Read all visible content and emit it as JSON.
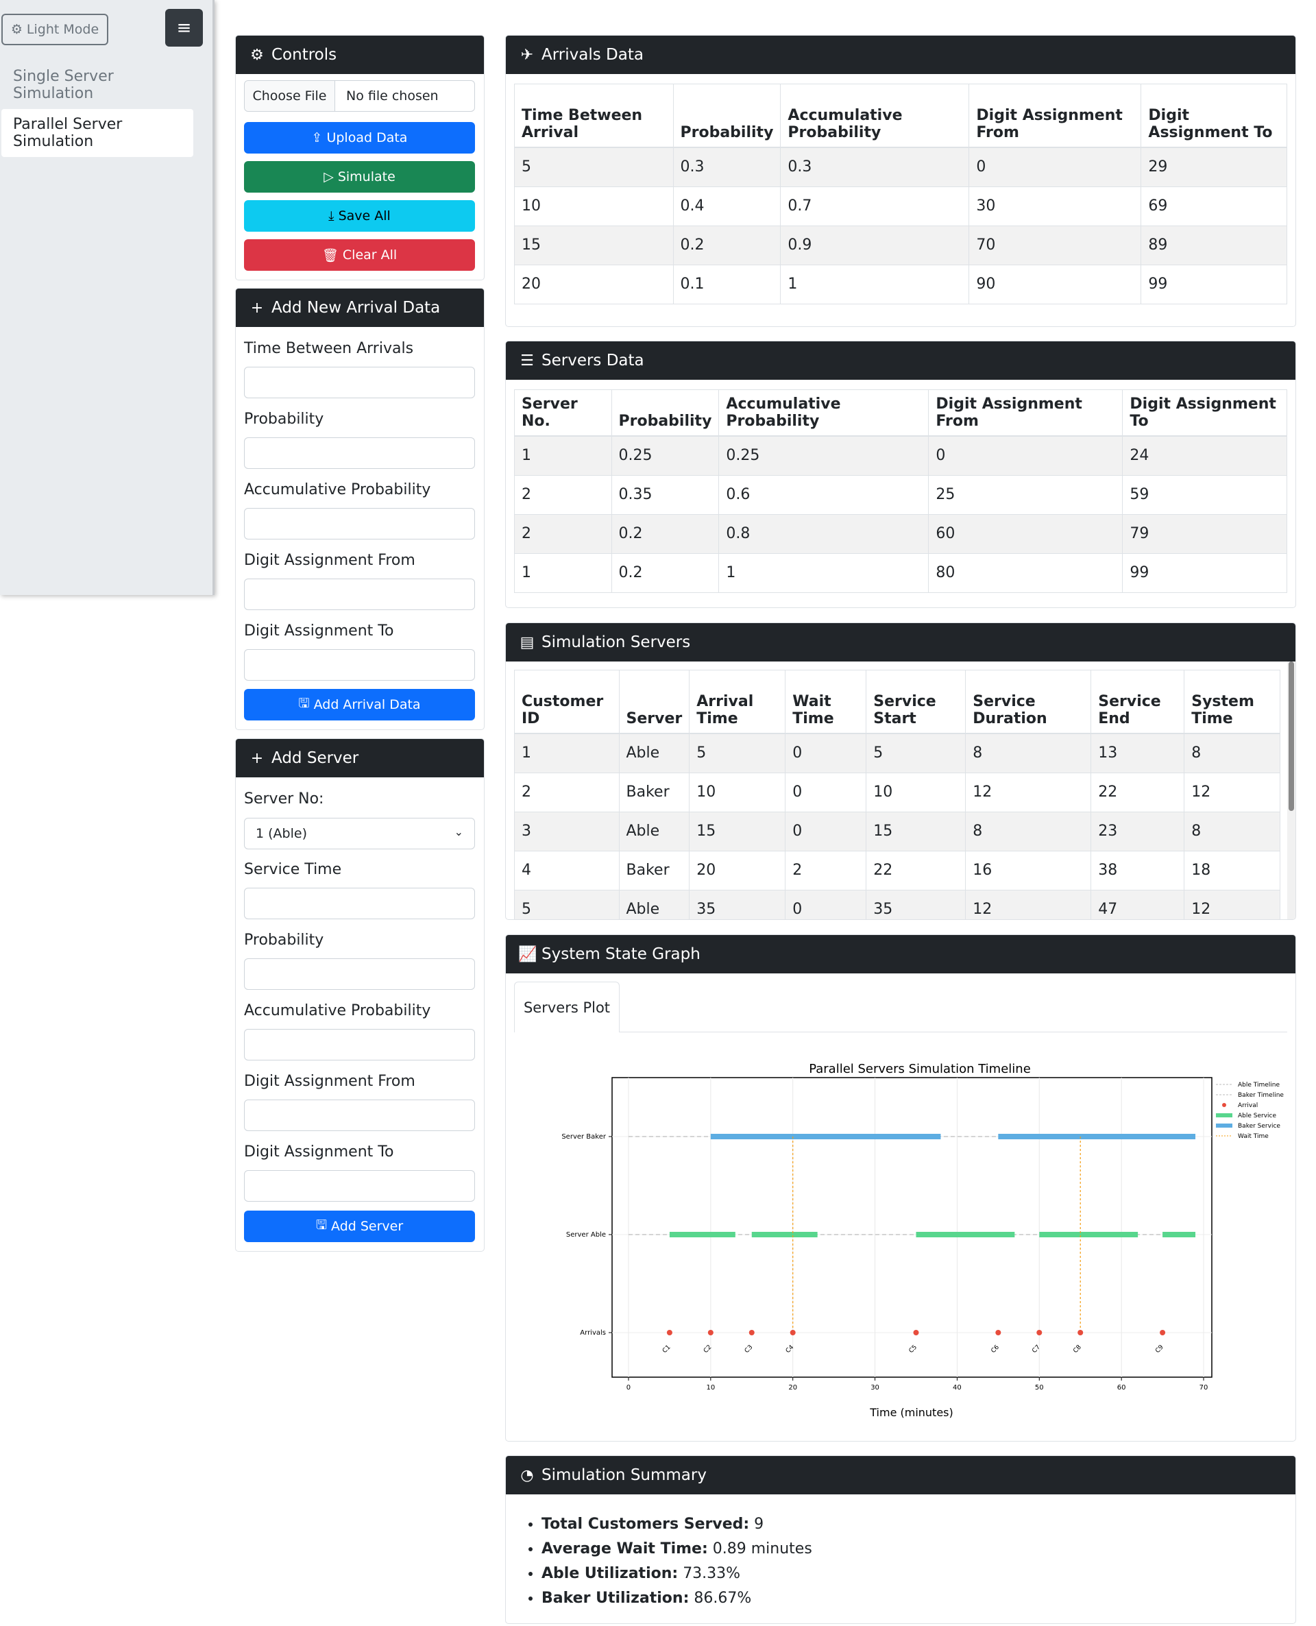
{
  "sidebar": {
    "mode_label": "Light Mode",
    "menu_icon": "hamburger-icon",
    "items": [
      {
        "label": "Single Server Simulation"
      },
      {
        "label": "Parallel Server Simulation"
      }
    ]
  },
  "controls": {
    "title": "Controls",
    "file_button": "Choose File",
    "file_status": "No file chosen",
    "upload_label": "Upload Data",
    "simulate_label": "Simulate",
    "save_label": "Save All",
    "clear_label": "Clear All"
  },
  "add_arrival": {
    "title": "Add New Arrival Data",
    "fields": [
      "Time Between Arrivals",
      "Probability",
      "Accumulative Probability",
      "Digit Assignment From",
      "Digit Assignment To"
    ],
    "button": "Add Arrival Data"
  },
  "add_server": {
    "title": "Add Server",
    "server_no_label": "Server No:",
    "server_no_value": "1 (Able)",
    "fields": [
      "Service Time",
      "Probability",
      "Accumulative Probability",
      "Digit Assignment From",
      "Digit Assignment To"
    ],
    "button": "Add Server"
  },
  "arrivals": {
    "title": "Arrivals Data",
    "headers": [
      "Time Between Arrival",
      "Probability",
      "Accumulative Probability",
      "Digit Assignment From",
      "Digit Assignment To"
    ],
    "rows": [
      [
        "5",
        "0.3",
        "0.3",
        "0",
        "29"
      ],
      [
        "10",
        "0.4",
        "0.7",
        "30",
        "69"
      ],
      [
        "15",
        "0.2",
        "0.9",
        "70",
        "89"
      ],
      [
        "20",
        "0.1",
        "1",
        "90",
        "99"
      ]
    ]
  },
  "servers": {
    "title": "Servers Data",
    "headers": [
      "Server No.",
      "Probability",
      "Accumulative Probability",
      "Digit Assignment From",
      "Digit Assignment To"
    ],
    "rows": [
      [
        "1",
        "0.25",
        "0.25",
        "0",
        "24"
      ],
      [
        "2",
        "0.35",
        "0.6",
        "25",
        "59"
      ],
      [
        "2",
        "0.2",
        "0.8",
        "60",
        "79"
      ],
      [
        "1",
        "0.2",
        "1",
        "80",
        "99"
      ]
    ]
  },
  "simulation": {
    "title": "Simulation Servers",
    "headers": [
      "Customer ID",
      "Server",
      "Arrival Time",
      "Wait Time",
      "Service Start",
      "Service Duration",
      "Service End",
      "System Time"
    ],
    "rows": [
      [
        "1",
        "Able",
        "5",
        "0",
        "5",
        "8",
        "13",
        "8"
      ],
      [
        "2",
        "Baker",
        "10",
        "0",
        "10",
        "12",
        "22",
        "12"
      ],
      [
        "3",
        "Able",
        "15",
        "0",
        "15",
        "8",
        "23",
        "8"
      ],
      [
        "4",
        "Baker",
        "20",
        "2",
        "22",
        "16",
        "38",
        "18"
      ],
      [
        "5",
        "Able",
        "35",
        "0",
        "35",
        "12",
        "47",
        "12"
      ]
    ]
  },
  "graph": {
    "title": "System State Graph",
    "tab": "Servers Plot"
  },
  "chart_data": {
    "type": "timeline",
    "title": "Parallel Servers Simulation Timeline",
    "xlabel": "Time (minutes)",
    "ylabel": "",
    "xlim": [
      -2,
      71
    ],
    "x_ticks": [
      0,
      10,
      20,
      30,
      40,
      50,
      60,
      70
    ],
    "y_categories": [
      "Arrivals",
      "Server Able",
      "Server Baker"
    ],
    "legend": [
      "Able Timeline",
      "Baker Timeline",
      "Arrival",
      "Able Service",
      "Baker Service",
      "Wait Time"
    ],
    "legend_position": "outside-top-right",
    "colors": {
      "able": "#58d68d",
      "baker": "#5dade2",
      "arrival": "#e74c3c",
      "wait": "#f39c12",
      "timeline": "#bbbbbb"
    },
    "able_service": [
      [
        5,
        13
      ],
      [
        15,
        23
      ],
      [
        35,
        47
      ],
      [
        50,
        62
      ],
      [
        65,
        69
      ]
    ],
    "baker_service": [
      [
        10,
        38
      ],
      [
        45,
        69
      ]
    ],
    "arrivals": [
      5,
      10,
      15,
      20,
      35,
      45,
      50,
      55,
      65
    ],
    "arrival_labels": [
      "C1",
      "C2",
      "C3",
      "C4",
      "C5",
      "C6",
      "C7",
      "C8",
      "C9"
    ],
    "wait_times": [
      20,
      55
    ]
  },
  "summary": {
    "title": "Simulation Summary",
    "items": [
      {
        "label": "Total Customers Served:",
        "value": "9"
      },
      {
        "label": "Average Wait Time:",
        "value": "0.89 minutes"
      },
      {
        "label": "Able Utilization:",
        "value": "73.33%"
      },
      {
        "label": "Baker Utilization:",
        "value": "86.67%"
      }
    ]
  }
}
